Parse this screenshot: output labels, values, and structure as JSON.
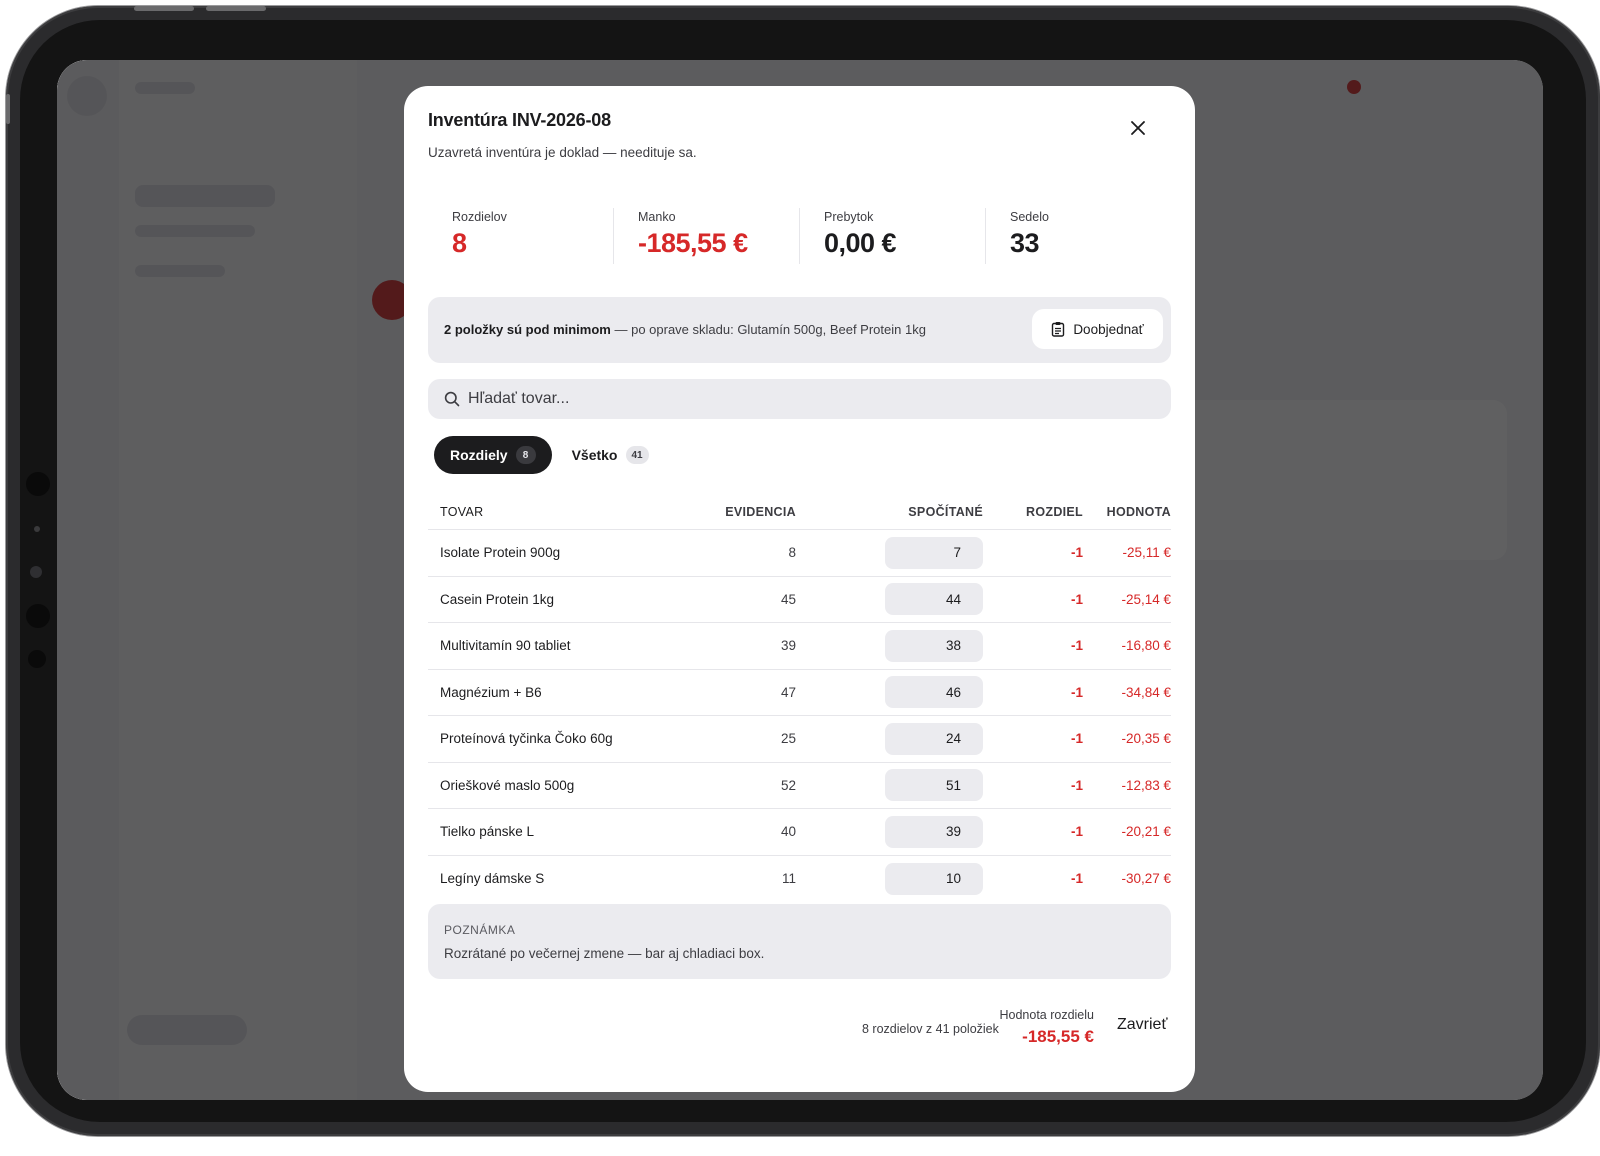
{
  "modal": {
    "title": "Inventúra INV-2026-08",
    "subtitle": "Uzavretá inventúra je doklad — needituje sa.",
    "stats": [
      {
        "label": "Rozdielov",
        "value": "8",
        "color": "#d62828"
      },
      {
        "label": "Manko",
        "value": "-185,55 €",
        "color": "#d62828"
      },
      {
        "label": "Prebytok",
        "value": "0,00 €",
        "color": "#1c1c1e"
      },
      {
        "label": "Sedelo",
        "value": "33",
        "color": "#1c1c1e"
      }
    ],
    "alert": {
      "bold": "2 položky sú pod minimom",
      "rest": " — po oprave skladu: Glutamín 500g, Beef Protein 1kg",
      "button": "Doobjednať"
    },
    "search": {
      "placeholder": "Hľadať tovar..."
    },
    "tabs": [
      {
        "label": "Rozdiely",
        "count": "8"
      },
      {
        "label": "Všetko",
        "count": "41"
      }
    ],
    "columns": {
      "product": "TOVAR",
      "record": "EVIDENCIA",
      "counted": "SPOČÍTANÉ",
      "difference": "ROZDIEL",
      "value": "HODNOTA"
    },
    "rows": [
      {
        "name": "Isolate Protein 900g",
        "record": "8",
        "counted": "7",
        "diff": "-1",
        "value": "-25,11 €"
      },
      {
        "name": "Casein Protein 1kg",
        "record": "45",
        "counted": "44",
        "diff": "-1",
        "value": "-25,14 €"
      },
      {
        "name": "Multivitamín 90 tabliet",
        "record": "39",
        "counted": "38",
        "diff": "-1",
        "value": "-16,80 €"
      },
      {
        "name": "Magnézium + B6",
        "record": "47",
        "counted": "46",
        "diff": "-1",
        "value": "-34,84 €"
      },
      {
        "name": "Proteínová tyčinka Čoko 60g",
        "record": "25",
        "counted": "24",
        "diff": "-1",
        "value": "-20,35 €"
      },
      {
        "name": "Orieškové maslo 500g",
        "record": "52",
        "counted": "51",
        "diff": "-1",
        "value": "-12,83 €"
      },
      {
        "name": "Tielko pánske L",
        "record": "40",
        "counted": "39",
        "diff": "-1",
        "value": "-20,21 €"
      },
      {
        "name": "Legíny dámske S",
        "record": "11",
        "counted": "10",
        "diff": "-1",
        "value": "-30,27 €"
      }
    ],
    "note": {
      "label": "POZNÁMKA",
      "text": "Rozrátané po večernej zmene — bar aj chladiaci box."
    },
    "footer": {
      "count_text": "8 rozdielov z 41 položiek",
      "total_label": "Hodnota rozdielu",
      "total_value": "-185,55 €",
      "close_label": "Zavrieť"
    }
  },
  "colors": {
    "accent_red": "#d62828",
    "dark": "#1c1c1e"
  },
  "icons": [
    "close-icon",
    "clipboard-icon",
    "search-icon"
  ]
}
